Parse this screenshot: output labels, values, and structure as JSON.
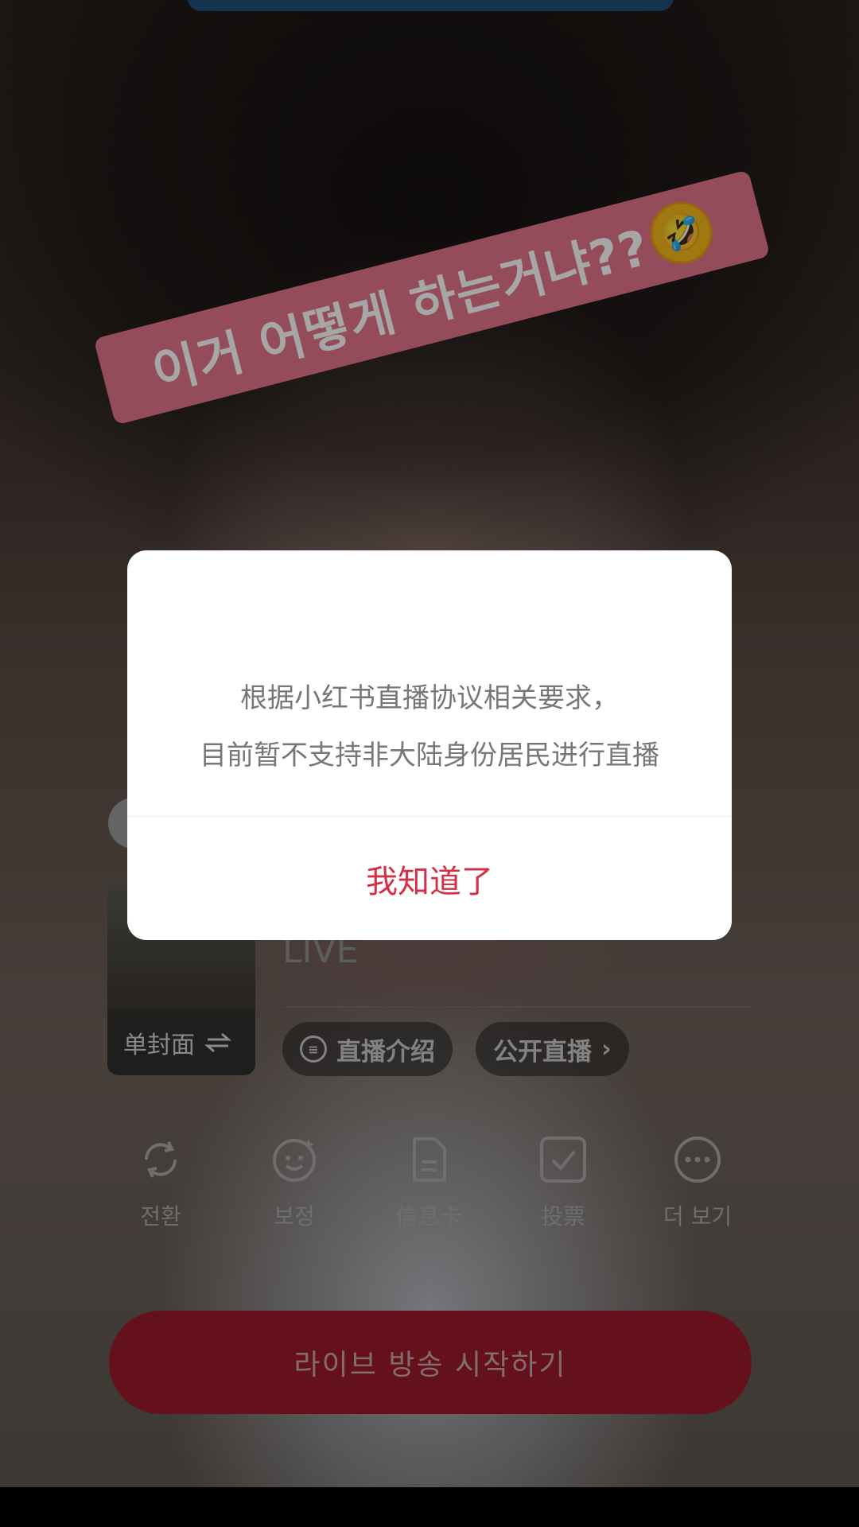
{
  "sticker": {
    "text": "이거 어떻게 하는거냐??",
    "emoji": "🤣"
  },
  "cover": {
    "label": "单封面",
    "icon": "swap-icon"
  },
  "live": {
    "title": "LIVE"
  },
  "pills": {
    "intro_label": "直播介绍",
    "public_label": "公开直播",
    "public_chevron": "›"
  },
  "tools": [
    {
      "label": "전환",
      "icon": "flip-camera-icon"
    },
    {
      "label": "보정",
      "icon": "beauty-face-icon"
    },
    {
      "label": "信息卡",
      "icon": "info-card-icon"
    },
    {
      "label": "投票",
      "icon": "vote-checkbox-icon"
    },
    {
      "label": "더 보기",
      "icon": "more-icon"
    }
  ],
  "start_button": {
    "label": "라이브 방송 시작하기"
  },
  "dialog": {
    "line1": "根据小红书直播协议相关要求，",
    "line2": "目前暂不支持非大陆身份居民进行直播",
    "confirm_label": "我知道了"
  },
  "colors": {
    "accent_red": "#d32f46",
    "button_red": "#9b1b2a",
    "sticker_pink": "#e4768a"
  }
}
